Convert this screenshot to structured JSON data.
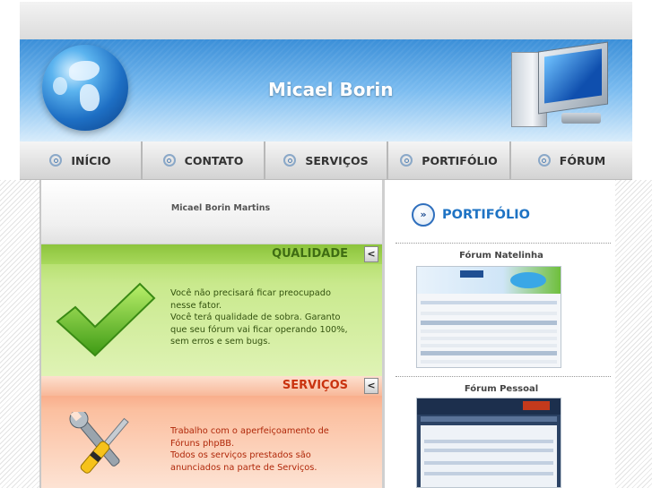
{
  "header": {
    "title": "Micael Borin"
  },
  "nav": {
    "items": [
      {
        "label": "INÍCIO"
      },
      {
        "label": "CONTATO"
      },
      {
        "label": "SERVIÇOS"
      },
      {
        "label": "PORTIFÓLIO"
      },
      {
        "label": "FÓRUM"
      }
    ]
  },
  "left": {
    "name": "Micael Borin Martins",
    "qualidade": {
      "title": "QUALIDADE",
      "toggle": "<",
      "text": "Você não precisará ficar preocupado\nnesse fator.\nVocê terá qualidade de sobra. Garanto\nque seu fórum vai ficar operando 100%,\nsem erros e sem bugs."
    },
    "servicos": {
      "title": "SERVIÇOS",
      "toggle": "<",
      "text": "Trabalho com o aperfeiçoamento de\nFóruns phpBB.\nTodos os serviços prestados são\nanunciados na parte de Serviços."
    }
  },
  "right": {
    "portfolio_badge": "»",
    "portfolio_title": "PORTIFÓLIO",
    "forums": [
      {
        "title": "Fórum Natelinha"
      },
      {
        "title": "Fórum Pessoal"
      }
    ]
  },
  "icons": {
    "nav": "bullet-circle-icon",
    "header_left": "globe-icon",
    "header_right": "computer-monitor-icon",
    "qualidade": "checkmark-icon",
    "servicos": "tools-icon"
  },
  "colors": {
    "header_blue": "#3b8fd8",
    "qualidade_green": "#a8d85c",
    "servicos_orange": "#f69670",
    "portfolio_blue": "#1e73c4"
  }
}
